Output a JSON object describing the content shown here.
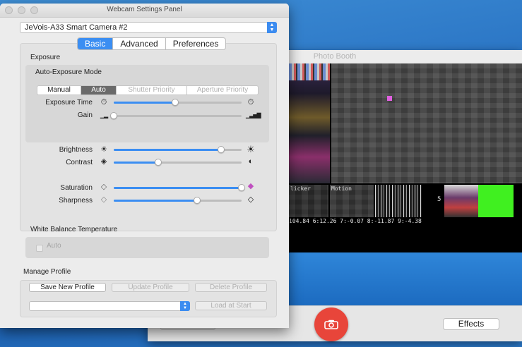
{
  "photo_booth": {
    "title": "Photo Booth",
    "effects_label": "Effects",
    "thumb_labels": [
      "licker",
      "Motion",
      "",
      "5"
    ],
    "stats_text": "104.84 6:12.26 7:-0.07 8:-11.87 9:-4.38"
  },
  "panel": {
    "title": "Webcam Settings Panel",
    "camera": "JeVois-A33 Smart Camera #2",
    "tabs": [
      "Basic",
      "Advanced",
      "Preferences"
    ],
    "active_tab": "Basic",
    "exposure_title": "Exposure",
    "ae_mode_title": "Auto-Exposure Mode",
    "ae_modes": [
      "Manual",
      "Auto",
      "Shutter Priority",
      "Aperture Priority"
    ],
    "ae_active": "Auto",
    "sliders": {
      "exposure_time": {
        "label": "Exposure Time",
        "value": 0.48
      },
      "gain": {
        "label": "Gain",
        "value": 0.0
      },
      "brightness": {
        "label": "Brightness",
        "value": 0.84
      },
      "contrast": {
        "label": "Contrast",
        "value": 0.35
      },
      "saturation": {
        "label": "Saturation",
        "value": 1.0
      },
      "sharpness": {
        "label": "Sharpness",
        "value": 0.65
      }
    },
    "wb_title": "White Balance Temperature",
    "wb_auto_label": "Auto",
    "manage_profile_title": "Manage Profile",
    "buttons": {
      "save_new": "Save New Profile",
      "update": "Update Profile",
      "delete": "Delete Profile",
      "load_at_start": "Load at Start"
    }
  },
  "colors": {
    "accent": "#3b8ef2",
    "shutter": "#e8453a",
    "green_block": "#40f020"
  }
}
